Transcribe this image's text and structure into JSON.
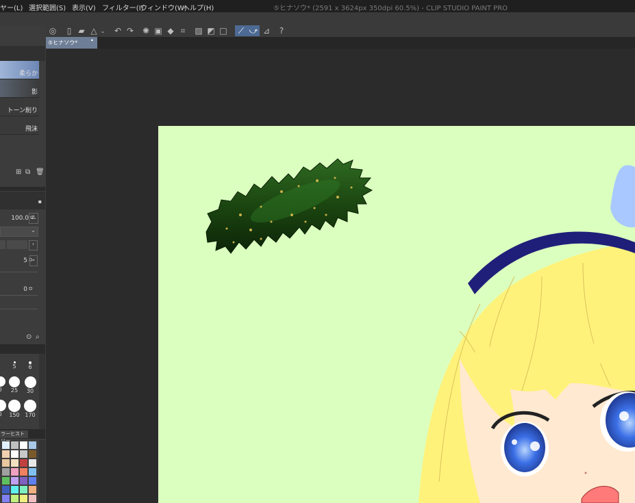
{
  "app": {
    "window_title": "⑤ヒナソウ* (2591 x 3624px 350dpi 60.5%)  - CLIP STUDIO PAINT PRO"
  },
  "menu": {
    "items": [
      "ヤー(L)",
      "選択範囲(S)",
      "表示(V)",
      "フィルター(I)",
      "ウィンドウ(W)",
      "ヘルプ(H)"
    ]
  },
  "toolbar": {
    "icons": [
      "sync-icon",
      "new-file-icon",
      "open-folder-icon",
      "save-icon",
      "chevron-down-icon",
      "undo-icon",
      "redo-icon",
      "lasso-icon",
      "clear-icon",
      "fill-icon",
      "crop-icon",
      "shape-icon",
      "snap-off-icon",
      "snap-square-icon",
      "pen-line-icon",
      "pen-curve-icon",
      "ruler-icon",
      "help-icon"
    ]
  },
  "document": {
    "tab_label": "⑤ヒナソウ*"
  },
  "brush_panel": {
    "items": [
      {
        "label": "柔らか",
        "selected": true
      },
      {
        "label": "影",
        "selected": false
      },
      {
        "label": "トーン削り",
        "selected": false
      },
      {
        "label": "飛沫",
        "selected": false
      }
    ]
  },
  "tool_property": {
    "opacity_value": "100.0",
    "row2_value": "5",
    "row3_value": "0"
  },
  "brush_size": {
    "sizes_row1": [
      "5",
      "6"
    ],
    "sizes_row2": [
      "0",
      "25",
      "30"
    ],
    "sizes_row3": [
      "0",
      "150",
      "170"
    ]
  },
  "color_history": {
    "title": "ラーヒストリー",
    "swatches": [
      "#e0f0ff",
      "#c0c0c0",
      "#ffffff",
      "#a8c8e8",
      "#f0d0b0",
      "#ffffff",
      "#c8c8c8",
      "#7a5a2a",
      "#e8c8a0",
      "#f0e0c0",
      "#c04040",
      "#e8e8e8",
      "#a0a0a0",
      "#f0a0c0",
      "#f08060",
      "#80c0f0",
      "#60c060",
      "#c0a0f0",
      "#8060c0",
      "#6080f0",
      "#4060c0",
      "#60f0f0",
      "#80f0c0",
      "#f0b080",
      "#8080f0",
      "#c0f080",
      "#f0f080",
      "#f0c0c0"
    ]
  },
  "colors": {
    "canvas_bg": "#dbffbf",
    "accent": "#4d6a94",
    "hair": "#fff27a",
    "headband": "#1f1f7a",
    "bow": "#a8c8ff",
    "eye": "#3a6ee8",
    "cucumber": "#1e4a12"
  }
}
